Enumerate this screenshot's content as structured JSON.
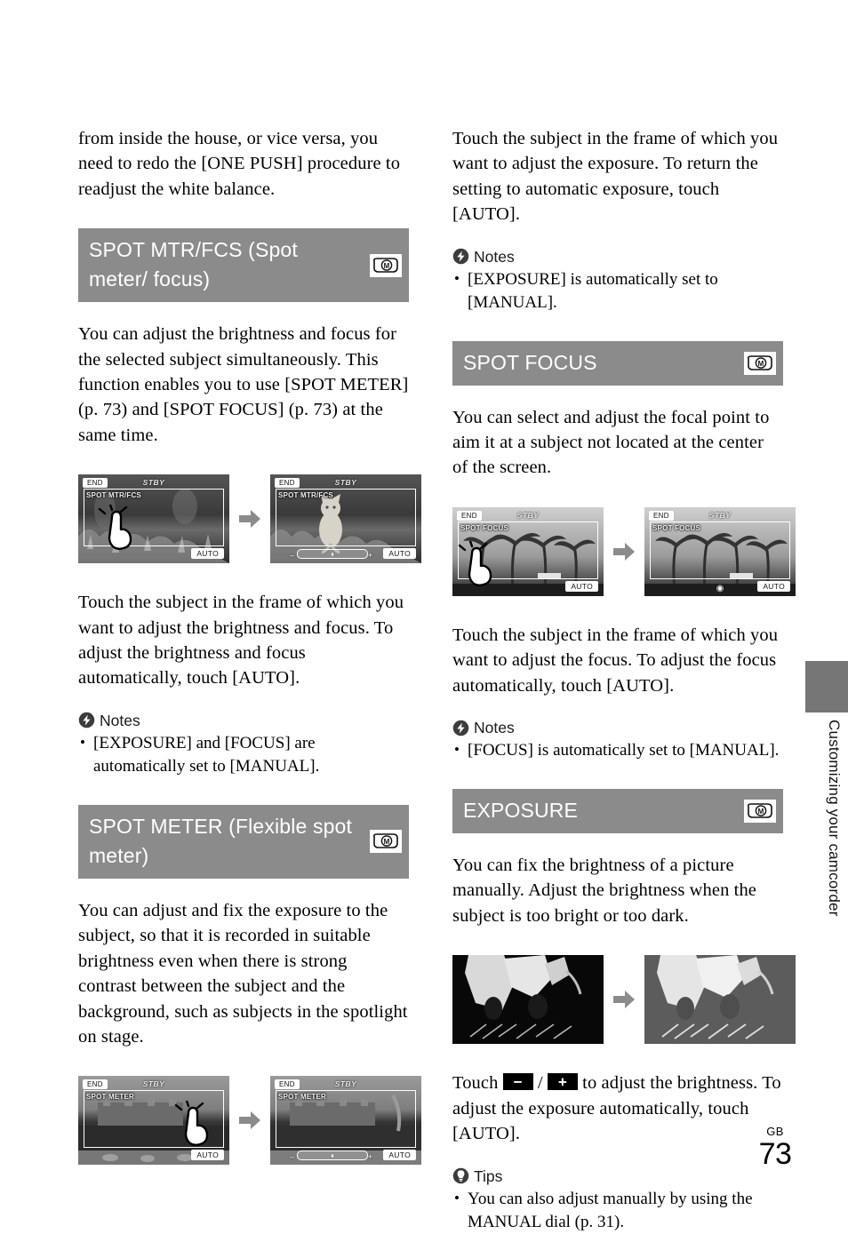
{
  "page": {
    "folio_prefix": "GB",
    "folio_number": "73",
    "side_tab_label": "Customizing your camcorder",
    "accent_gray": "#8b8b8b",
    "tab_gray": "#767676"
  },
  "left_column": {
    "intro_paragraph": "from inside the house, or vice versa, you need to redo the [ONE PUSH] procedure to readjust the white balance.",
    "sections": [
      {
        "title": "SPOT MTR/FCS (Spot meter/ focus)",
        "badge": "M",
        "body": "You can adjust the brightness and focus for the selected subject simultaneously. This function enables you to use [SPOT METER] (p. 73) and [SPOT FOCUS] (p. 73) at the same time.",
        "figure": {
          "before": {
            "end_label": "END",
            "status_label": "STBY",
            "mode_label": "SPOT MTR/FCS",
            "auto_label": "AUTO",
            "caption": "cat-in-grass-screen-with-touch-hand"
          },
          "after": {
            "end_label": "END",
            "status_label": "STBY",
            "mode_label": "SPOT MTR/FCS",
            "auto_label": "AUTO",
            "caption": "cat-in-grass-screen-focused"
          },
          "arrow": "arrow-right"
        },
        "instructions": "Touch the subject in the frame of which you want to adjust the brightness and focus. To adjust the brightness and focus automatically, touch [AUTO].",
        "callout": {
          "type": "notes",
          "heading": "Notes",
          "items": [
            "[EXPOSURE] and [FOCUS] are automatically set to [MANUAL]."
          ]
        }
      },
      {
        "title": "SPOT METER (Flexible spot meter)",
        "badge": "M",
        "body": "You can adjust and fix the exposure to the subject, so that it is recorded in suitable brightness even when there is strong contrast between the subject and the background, such as subjects in the spotlight on stage.",
        "figure": {
          "before": {
            "end_label": "END",
            "status_label": "STBY",
            "mode_label": "SPOT METER",
            "auto_label": "AUTO",
            "caption": "park-building-screen-with-touch-hand"
          },
          "after": {
            "end_label": "END",
            "status_label": "STBY",
            "mode_label": "SPOT METER",
            "auto_label": "AUTO",
            "caption": "park-building-screen-with-exposure-slider"
          },
          "arrow": "arrow-right"
        }
      }
    ]
  },
  "right_column": {
    "continued_instructions": "Touch the subject in the frame of which you want to adjust the exposure. To return the setting to automatic exposure, touch [AUTO].",
    "continued_callout": {
      "type": "notes",
      "heading": "Notes",
      "items": [
        "[EXPOSURE] is automatically set to [MANUAL]."
      ]
    },
    "sections": [
      {
        "title": "SPOT FOCUS",
        "badge": "M",
        "body": "You can select and adjust the focal point to aim it at a subject not located at the center of the screen.",
        "figure": {
          "before": {
            "end_label": "END",
            "status_label": "STBY",
            "mode_label": "SPOT FOCUS",
            "auto_label": "AUTO",
            "caption": "palm-trees-screen-with-touch-hand"
          },
          "after": {
            "end_label": "END",
            "status_label": "STBY",
            "mode_label": "SPOT FOCUS",
            "auto_label": "AUTO",
            "caption": "palm-trees-screen-focused"
          },
          "arrow": "arrow-right"
        },
        "instructions": "Touch the subject in the frame of which you want to adjust the focus. To adjust the focus automatically, touch [AUTO].",
        "callout": {
          "type": "notes",
          "heading": "Notes",
          "items": [
            "[FOCUS] is automatically set to [MANUAL]."
          ]
        }
      },
      {
        "title": "EXPOSURE",
        "badge": "M",
        "body": "You can fix the brightness of a picture manually. Adjust the brightness when the subject is too bright or too dark.",
        "figure": {
          "before": {
            "caption": "birds-photo-underexposed"
          },
          "after": {
            "caption": "birds-photo-corrected-exposure"
          },
          "arrow": "arrow-right"
        },
        "instructions_prefix": "Touch ",
        "key_minus": "−",
        "key_separator": " / ",
        "instructions_suffix": " to adjust the brightness. To adjust the exposure automatically, touch [AUTO].",
        "key_plus": "+",
        "callout": {
          "type": "tips",
          "heading": "Tips",
          "items": [
            "You can also adjust manually by using the MANUAL dial (p. 31)."
          ]
        }
      }
    ]
  }
}
